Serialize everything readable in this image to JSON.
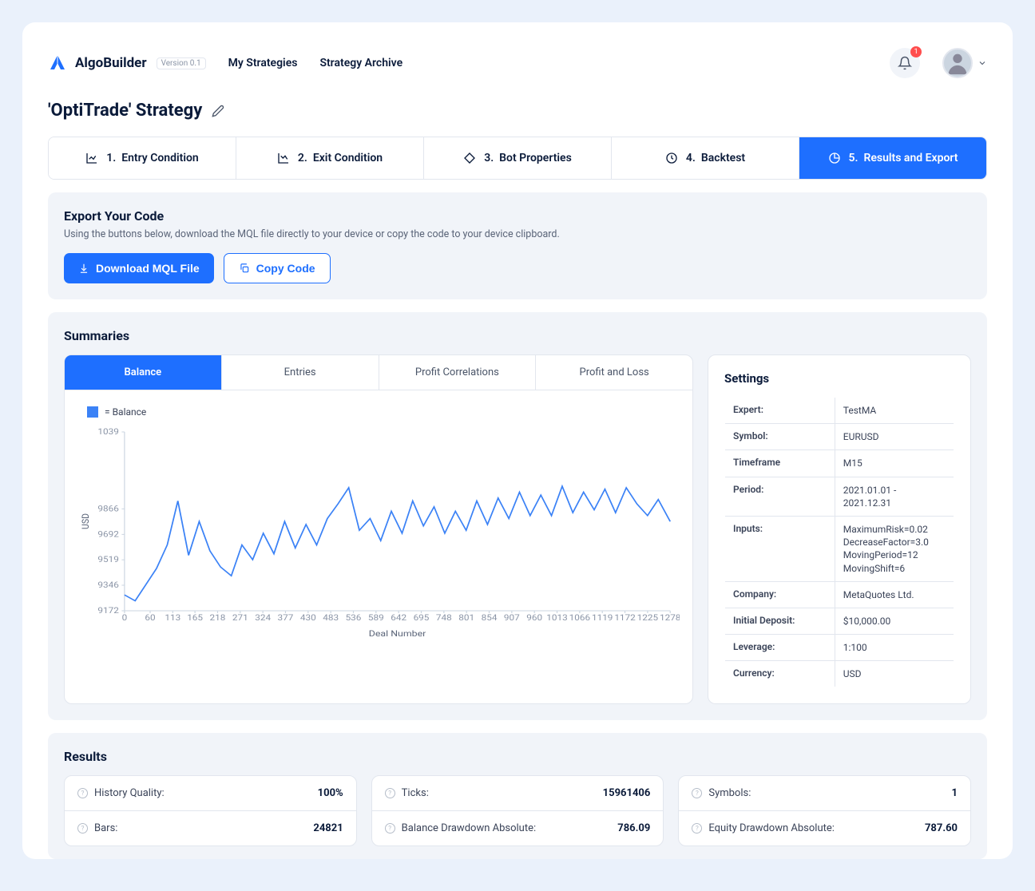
{
  "brand": {
    "name": "AlgoBuilder",
    "version": "Version 0.1"
  },
  "nav": {
    "links": [
      "My Strategies",
      "Strategy Archive"
    ],
    "badge": "1"
  },
  "page": {
    "title": "'OptiTrade' Strategy"
  },
  "wizard": [
    {
      "num": "1.",
      "label": "Entry Condition"
    },
    {
      "num": "2.",
      "label": "Exit Condition"
    },
    {
      "num": "3.",
      "label": "Bot Properties"
    },
    {
      "num": "4.",
      "label": "Backtest"
    },
    {
      "num": "5.",
      "label": "Results and Export"
    }
  ],
  "export": {
    "title": "Export Your Code",
    "desc": "Using the  buttons below, download the MQL file directly to your device or copy the code to your device clipboard.",
    "download": "Download MQL File",
    "copy": "Copy Code"
  },
  "summaries": {
    "title": "Summaries",
    "tabs": [
      "Balance",
      "Entries",
      "Profit Correlations",
      "Profit and Loss"
    ],
    "legend": "= Balance",
    "xlabel": "Deal Number",
    "ylabel": "USD"
  },
  "settings": {
    "title": "Settings",
    "rows": [
      {
        "k": "Expert:",
        "v": "TestMA"
      },
      {
        "k": "Symbol:",
        "v": "EURUSD"
      },
      {
        "k": "Timeframe",
        "v": "M15"
      },
      {
        "k": "Period:",
        "v": " 2021.01.01 - 2021.12.31"
      },
      {
        "k": "Inputs:",
        "v": "MaximumRisk=0.02\nDecreaseFactor=3.0\nMovingPeriod=12\nMovingShift=6"
      },
      {
        "k": "Company:",
        "v": "MetaQuotes Ltd."
      },
      {
        "k": "Initial Deposit:",
        "v": "$10,000.00"
      },
      {
        "k": "Leverage:",
        "v": "1:100"
      },
      {
        "k": "Currency:",
        "v": "USD"
      }
    ]
  },
  "results": {
    "title": "Results",
    "cols": [
      [
        {
          "label": "History Quality:",
          "value": "100%"
        },
        {
          "label": "Bars:",
          "value": "24821"
        }
      ],
      [
        {
          "label": "Ticks:",
          "value": "15961406"
        },
        {
          "label": "Balance Drawdown Absolute:",
          "value": "786.09"
        }
      ],
      [
        {
          "label": "Symbols:",
          "value": "1"
        },
        {
          "label": "Equity Drawdown Absolute:",
          "value": "787.60"
        }
      ]
    ]
  },
  "chart_data": {
    "type": "line",
    "title": "Balance",
    "xlabel": "Deal Number",
    "ylabel": "USD",
    "ylim": [
      9172,
      10390
    ],
    "y_ticks": [
      9172,
      9346,
      9519,
      9692,
      9866,
      10390
    ],
    "y_tick_labels": [
      "9172",
      "9346",
      "9519",
      "9692",
      "9866",
      "1039"
    ],
    "x_ticks": [
      0,
      60,
      113,
      165,
      218,
      271,
      324,
      377,
      430,
      483,
      536,
      589,
      642,
      695,
      748,
      801,
      854,
      907,
      960,
      1013,
      1066,
      1119,
      1172,
      1225,
      1278
    ],
    "series": [
      {
        "name": "Balance",
        "color": "#3b82f6",
        "x": [
          0,
          25,
          50,
          75,
          100,
          125,
          150,
          175,
          200,
          225,
          250,
          275,
          300,
          325,
          350,
          375,
          400,
          425,
          450,
          475,
          500,
          525,
          550,
          575,
          600,
          625,
          650,
          675,
          700,
          725,
          750,
          775,
          800,
          825,
          850,
          875,
          900,
          925,
          950,
          975,
          1000,
          1025,
          1050,
          1075,
          1100,
          1125,
          1150,
          1175,
          1200,
          1225,
          1250,
          1278
        ],
        "values": [
          9280,
          9240,
          9350,
          9460,
          9620,
          9920,
          9550,
          9780,
          9580,
          9470,
          9410,
          9620,
          9520,
          9700,
          9560,
          9780,
          9600,
          9760,
          9620,
          9800,
          9900,
          10010,
          9720,
          9800,
          9650,
          9850,
          9700,
          9920,
          9750,
          9880,
          9700,
          9850,
          9720,
          9920,
          9760,
          9940,
          9800,
          9980,
          9820,
          9960,
          9820,
          10020,
          9840,
          9980,
          9860,
          10000,
          9840,
          10010,
          9900,
          9820,
          9930,
          9780
        ]
      }
    ]
  }
}
